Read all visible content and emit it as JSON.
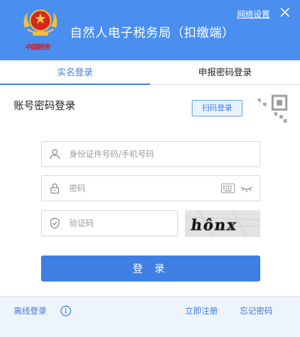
{
  "header": {
    "app_title": "自然人电子税务局（扣缴端）",
    "emblem_text": "中国税务",
    "network_settings": "网络设置",
    "bg_color": "#4a8ef0"
  },
  "tabs": [
    {
      "label": "实名登录",
      "active": true
    },
    {
      "label": "申报密码登录",
      "active": false
    }
  ],
  "login": {
    "section_title": "账号密码登录",
    "scan_button": "扫码登录",
    "id_placeholder": "身份证件号码/手机号码",
    "password_placeholder": "密码",
    "code_placeholder": "验证码",
    "captcha_text": "hônx",
    "submit_label": "登 录",
    "accent_color": "#3f7fe3"
  },
  "footer": {
    "offline_login": "离线登录",
    "register": "立即注册",
    "forgot_password": "忘记密码"
  },
  "icons": [
    "emblem-icon",
    "close-icon",
    "qr-code-icon",
    "user-icon",
    "lock-icon",
    "keyboard-icon",
    "eye-closed-icon",
    "shield-icon",
    "info-icon"
  ]
}
